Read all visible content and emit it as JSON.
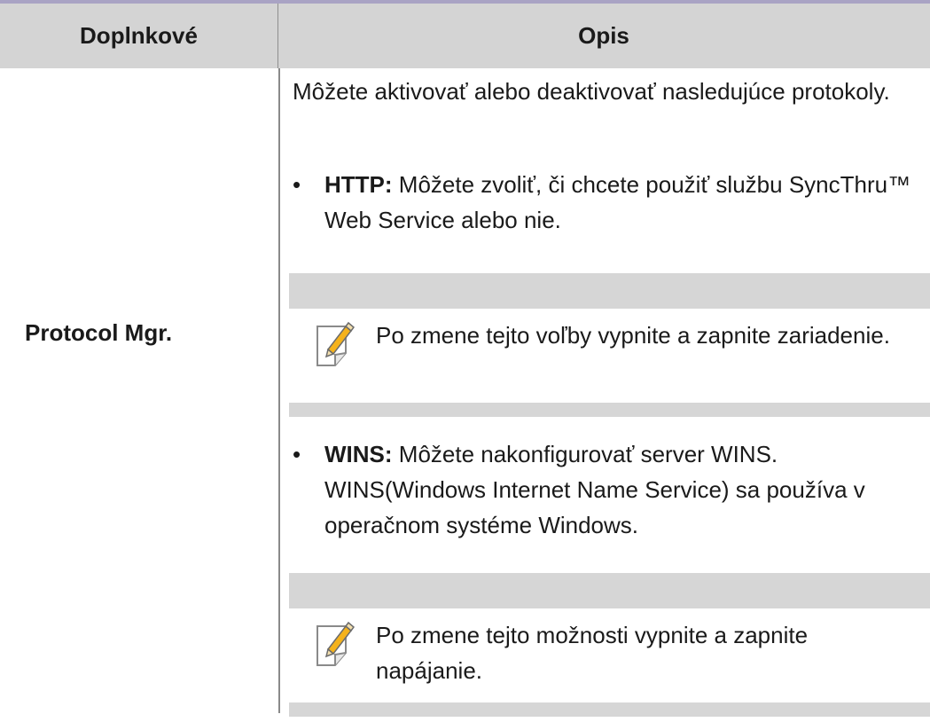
{
  "table": {
    "headers": [
      "Doplnkové",
      "Opis"
    ],
    "row_label": "Protocol Mgr.",
    "intro": "Môžete aktivovať alebo deaktivovať nasledujúce protokoly.",
    "bullet_http": {
      "term": "HTTP:",
      "text": "Môžete zvoliť, či chcete použiť službu SyncThru™ Web Service alebo nie."
    },
    "note1": "Po zmene tejto voľby vypnite a zapnite zariadenie.",
    "bullet_wins": {
      "term": "WINS:",
      "text": "Môžete nakonfigurovať server WINS. WINS(Windows Internet Name Service) sa používa v operačnom systéme Windows."
    },
    "note2": "Po zmene tejto možnosti vypnite a zapnite napájanie.",
    "note_icon": "pencil-note-icon",
    "bullet_symbol": "•"
  }
}
